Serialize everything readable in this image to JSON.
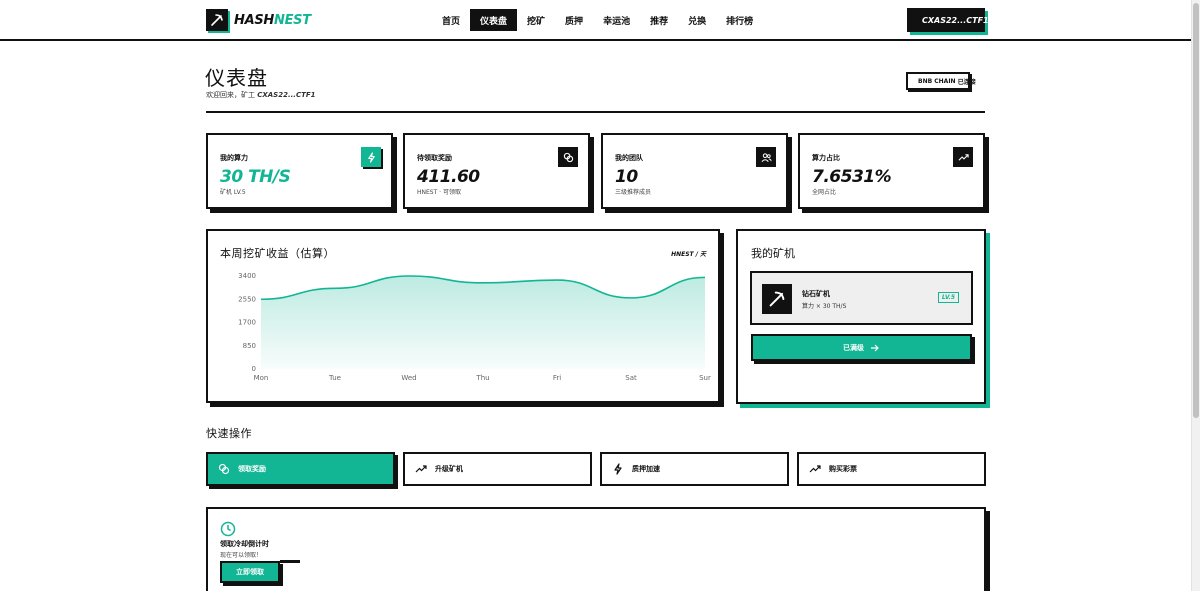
{
  "header": {
    "logo_main": "HASH",
    "logo_accent": "NEST",
    "nav": [
      "首页",
      "仪表盘",
      "挖矿",
      "质押",
      "幸运池",
      "推荐",
      "兑换",
      "排行榜"
    ],
    "active_nav": "仪表盘",
    "wallet": "CXAS22...CTF1"
  },
  "page": {
    "title": "仪表盘",
    "welcome_prefix": "欢迎回来，矿工",
    "welcome_user": "CXAS22...CTF1",
    "chain_name": "BNB CHAIN",
    "chain_status": "已连接"
  },
  "stats": [
    {
      "label": "我的算力",
      "value": "30 TH/S",
      "sub": "矿机 LV.5",
      "icon": "lightning-icon",
      "accent": true
    },
    {
      "label": "待领取奖励",
      "value": "411.60",
      "sub": "HNEST · 可领取",
      "icon": "coins-icon",
      "accent": false
    },
    {
      "label": "我的团队",
      "value": "10",
      "sub": "三级推荐成员",
      "icon": "users-icon",
      "accent": false
    },
    {
      "label": "算力占比",
      "value": "7.6531%",
      "sub": "全网占比",
      "icon": "trending-up-icon",
      "accent": false
    }
  ],
  "chart": {
    "title": "本周挖矿收益（估算）",
    "unit": "HNEST / 天"
  },
  "chart_data": {
    "type": "area",
    "title": "本周挖矿收益（估算）",
    "unit": "HNEST / 天",
    "categories": [
      "Mon",
      "Tue",
      "Wed",
      "Thu",
      "Fri",
      "Sat",
      "Sur"
    ],
    "values": [
      2550,
      2950,
      3400,
      3150,
      3250,
      2600,
      3350
    ],
    "y_ticks": [
      0,
      850,
      1700,
      2550,
      3400
    ],
    "ylim": [
      0,
      3400
    ],
    "grid": false,
    "color": "#12b594"
  },
  "miner": {
    "title": "我的矿机",
    "name": "钻石矿机",
    "power": "算力 × 30 TH/S",
    "level": "LV.5",
    "button": "已满级"
  },
  "quick_actions": {
    "title": "快速操作",
    "items": [
      {
        "label": "领取奖励",
        "icon": "coins-icon",
        "primary": true
      },
      {
        "label": "升级矿机",
        "icon": "trending-up-icon",
        "primary": false
      },
      {
        "label": "质押加速",
        "icon": "lightning-icon",
        "primary": false
      },
      {
        "label": "购买彩票",
        "icon": "trending-up-icon",
        "primary": false
      }
    ]
  },
  "cooldown": {
    "title": "领取冷却倒计时",
    "sub": "现在可以领取！",
    "button": "立即领取"
  },
  "colors": {
    "accent": "#12b594",
    "ink": "#111111"
  }
}
